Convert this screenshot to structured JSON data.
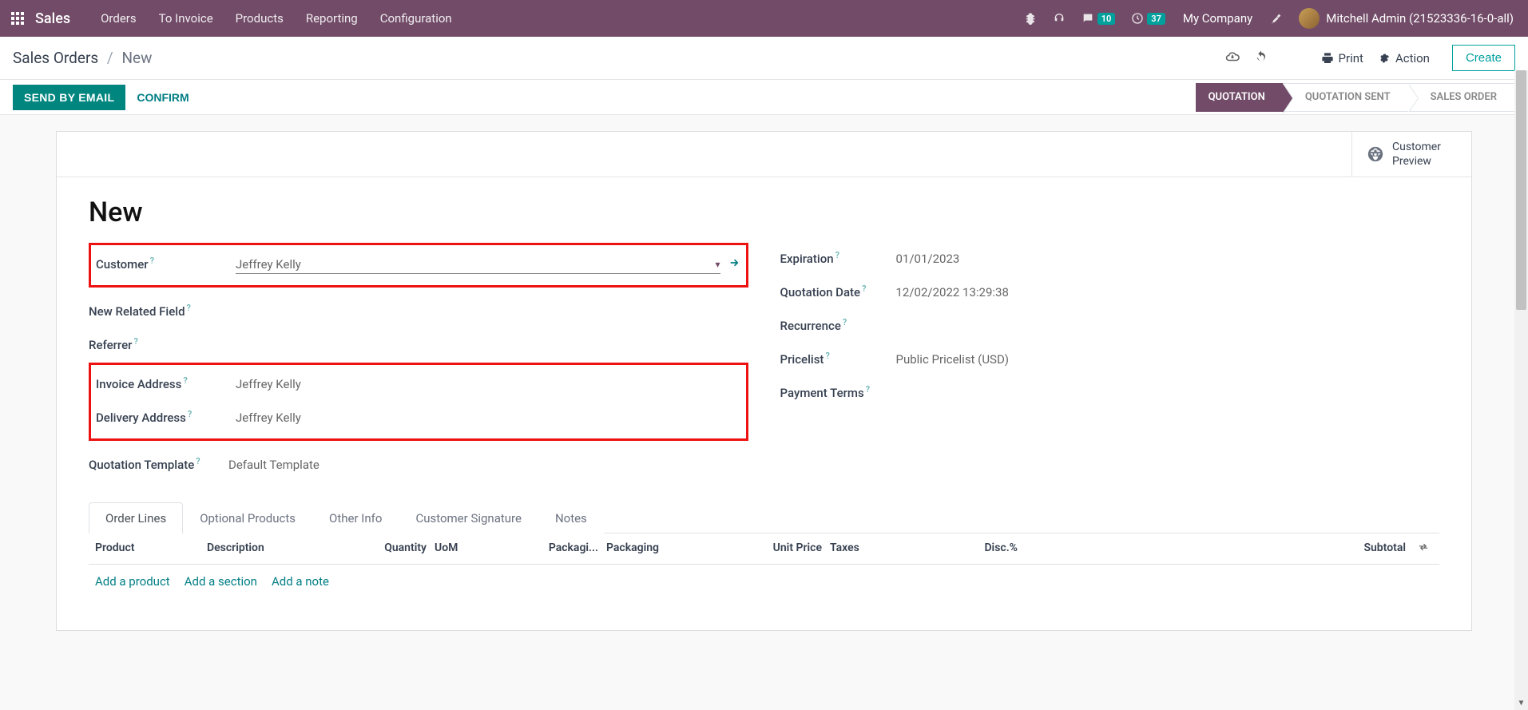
{
  "nav": {
    "brand": "Sales",
    "menu": [
      "Orders",
      "To Invoice",
      "Products",
      "Reporting",
      "Configuration"
    ],
    "messages_badge": "10",
    "activities_badge": "37",
    "company": "My Company",
    "user": "Mitchell Admin (21523336-16-0-all)"
  },
  "breadcrumb": {
    "root": "Sales Orders",
    "current": "New"
  },
  "header_actions": {
    "print": "Print",
    "action": "Action",
    "create": "Create"
  },
  "statusbar": {
    "send": "SEND BY EMAIL",
    "confirm": "CONFIRM",
    "stages": [
      "QUOTATION",
      "QUOTATION SENT",
      "SALES ORDER"
    ]
  },
  "button_box": {
    "customer_preview_l1": "Customer",
    "customer_preview_l2": "Preview"
  },
  "form": {
    "title": "New",
    "left": {
      "customer_label": "Customer",
      "customer_value": "Jeffrey Kelly",
      "new_related_label": "New Related Field",
      "referrer_label": "Referrer",
      "invoice_addr_label": "Invoice Address",
      "invoice_addr_value": "Jeffrey Kelly",
      "delivery_addr_label": "Delivery Address",
      "delivery_addr_value": "Jeffrey Kelly",
      "quote_tpl_label": "Quotation Template",
      "quote_tpl_value": "Default Template"
    },
    "right": {
      "expiration_label": "Expiration",
      "expiration_value": "01/01/2023",
      "quotation_date_label": "Quotation Date",
      "quotation_date_value": "12/02/2022 13:29:38",
      "recurrence_label": "Recurrence",
      "pricelist_label": "Pricelist",
      "pricelist_value": "Public Pricelist (USD)",
      "payment_terms_label": "Payment Terms"
    }
  },
  "tabs": [
    "Order Lines",
    "Optional Products",
    "Other Info",
    "Customer Signature",
    "Notes"
  ],
  "columns": {
    "product": "Product",
    "description": "Description",
    "quantity": "Quantity",
    "uom": "UoM",
    "pkgqty": "Packagi...",
    "packaging": "Packaging",
    "unit_price": "Unit Price",
    "taxes": "Taxes",
    "disc": "Disc.%",
    "subtotal": "Subtotal"
  },
  "add_links": {
    "product": "Add a product",
    "section": "Add a section",
    "note": "Add a note"
  }
}
